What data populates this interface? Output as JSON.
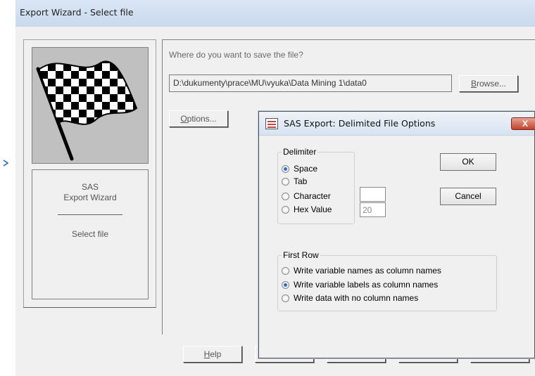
{
  "window": {
    "title": "Export Wizard - Select file"
  },
  "left_panel": {
    "flag_icon": "checkered-flag",
    "info_title": "SAS",
    "info_subtitle": "Export Wizard",
    "info_step": "Select file"
  },
  "file": {
    "prompt": "Where do you want to save the file?",
    "path": "D:\\dukumenty\\prace\\MU\\vyuka\\Data Mining 1\\data0",
    "browse_label": "Browse...",
    "options_label": "Options..."
  },
  "footer": {
    "help_label": "Help"
  },
  "dialog": {
    "title": "SAS Export: Delimited File Options",
    "close_label": "X",
    "delimiter": {
      "label": "Delimiter",
      "options": [
        "Space",
        "Tab",
        "Character",
        "Hex Value"
      ],
      "selected": "Space",
      "character_value": "",
      "hex_value": "20"
    },
    "ok_label": "OK",
    "cancel_label": "Cancel",
    "first_row": {
      "label": "First Row",
      "options": [
        "Write variable names as column names",
        "Write variable labels as column names",
        "Write data with no column names"
      ],
      "selected": "Write variable labels as column names"
    }
  },
  "colors": {
    "titlebar": "#c9d9ee",
    "close_button": "#c2412d",
    "radio_selected": "#2a6fc9"
  }
}
